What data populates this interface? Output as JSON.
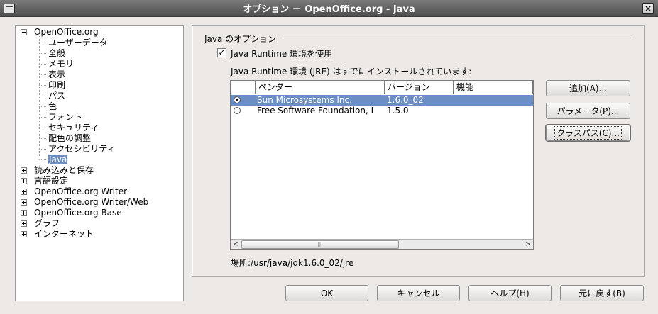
{
  "window": {
    "title": "オプション － OpenOffice.org - Java",
    "close_glyph": "×"
  },
  "tree": {
    "root": "OpenOffice.org",
    "children": [
      "ユーザーデータ",
      "全般",
      "メモリ",
      "表示",
      "印刷",
      "パス",
      "色",
      "フォント",
      "セキュリティ",
      "配色の調整",
      "アクセシビリティ",
      "Java"
    ],
    "selected": "Java",
    "top_nodes": [
      "読み込みと保存",
      "言語設定",
      "OpenOffice.org Writer",
      "OpenOffice.org Writer/Web",
      "OpenOffice.org Base",
      "グラフ",
      "インターネット"
    ]
  },
  "java": {
    "group_title": "Java のオプション",
    "use_runtime_label": "Java Runtime 環境を使用",
    "use_runtime_checked": true,
    "checkbox_glyph": "✓",
    "list_label": "Java Runtime 環境 (JRE) はすでにインストールされています:",
    "columns": [
      "ベンダー",
      "バージョン",
      "機能"
    ],
    "rows": [
      {
        "vendor": "Sun Microsystems Inc.",
        "version": "1.6.0_02",
        "feature": "",
        "selected": true
      },
      {
        "vendor": "Free Software Foundation, I",
        "version": "1.5.0",
        "feature": "",
        "selected": false
      }
    ],
    "scroll_left": "<",
    "scroll_right": ">",
    "scroll_grip": "|||",
    "location": "場所:/usr/java/jdk1.6.0_02/jre"
  },
  "side_buttons": {
    "add": "追加(A)...",
    "params": "パラメータ(P)...",
    "classpath": "クラスパス(C)..."
  },
  "footer_buttons": {
    "ok": "OK",
    "cancel": "キャンセル",
    "help": "ヘルプ(H)",
    "reset": "元に戻す(B)"
  }
}
